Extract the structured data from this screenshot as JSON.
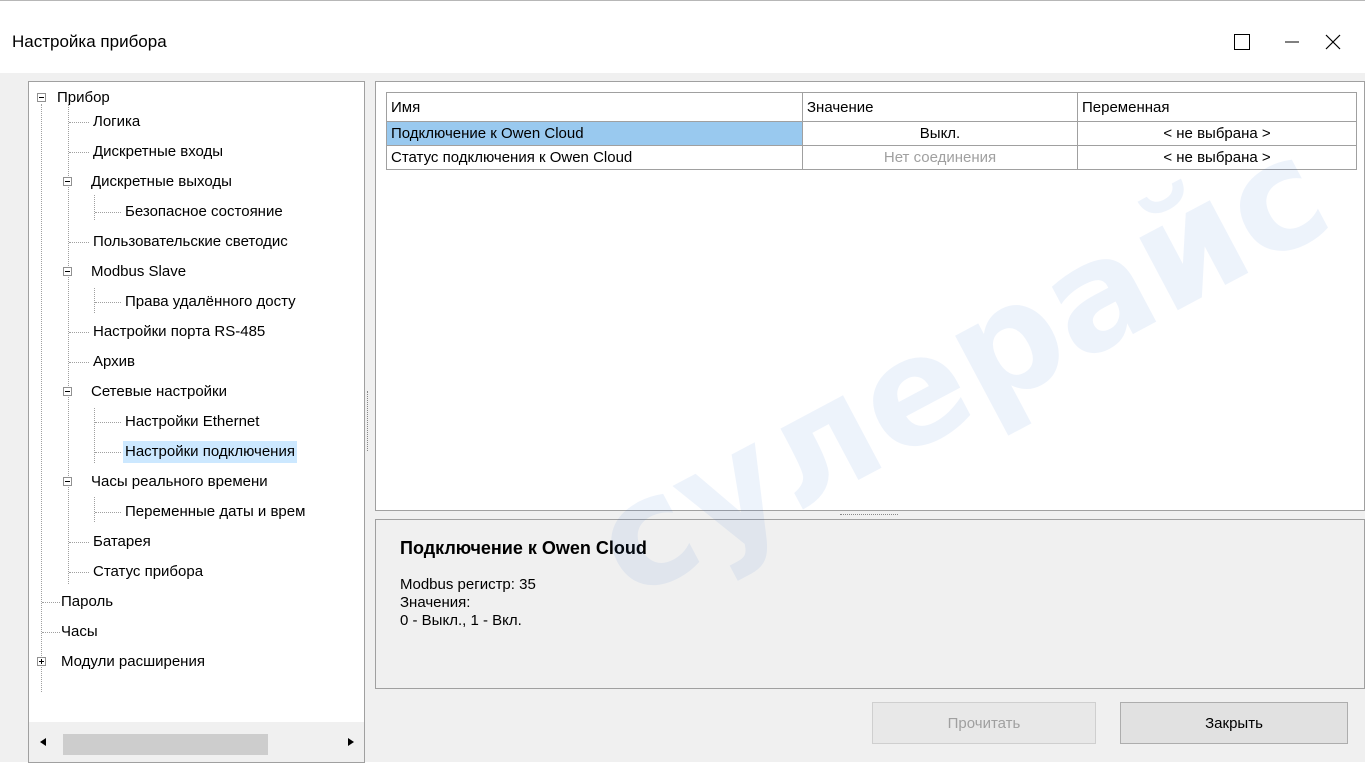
{
  "window": {
    "title": "Настройка прибора",
    "minimize_label": "—",
    "maximize_label": "☐",
    "close_label": "✕"
  },
  "tree": {
    "items": [
      {
        "label": "Прибор"
      },
      {
        "label": "Логика"
      },
      {
        "label": "Дискретные входы"
      },
      {
        "label": "Дискретные выходы"
      },
      {
        "label": "Безопасное состояние"
      },
      {
        "label": "Пользовательские светодис"
      },
      {
        "label": "Modbus Slave"
      },
      {
        "label": "Права удалённого досту"
      },
      {
        "label": "Настройки порта RS-485"
      },
      {
        "label": "Архив"
      },
      {
        "label": "Сетевые настройки"
      },
      {
        "label": "Настройки Ethernet"
      },
      {
        "label": "Настройки подключения"
      },
      {
        "label": "Часы реального времени"
      },
      {
        "label": "Переменные даты и врем"
      },
      {
        "label": "Батарея"
      },
      {
        "label": "Статус прибора"
      },
      {
        "label": "Пароль"
      },
      {
        "label": "Часы"
      },
      {
        "label": "Модули расширения"
      }
    ],
    "selected_index": 12
  },
  "grid": {
    "columns": [
      "Имя",
      "Значение",
      "Переменная"
    ],
    "rows": [
      {
        "name": "Подключение к Owen Cloud",
        "value": "Выкл.",
        "variable": "< не выбрана >"
      },
      {
        "name": "Статус подключения к Owen Cloud",
        "value": "Нет соединения",
        "variable": "< не выбрана >"
      }
    ]
  },
  "description": {
    "title": "Подключение к Owen Cloud",
    "line1": "Modbus регистр: 35",
    "line2": "Значения:",
    "line3": "0 - Выкл., 1 - Вкл."
  },
  "buttons": {
    "read_label": "Прочитать",
    "close_label": "Закрыть"
  },
  "watermark": {
    "text": "сулерайс"
  },
  "colors": {
    "selected_row": "#99c9ef",
    "selected_tree": "#cce8ff",
    "window_bg": "#f0f0f0"
  }
}
